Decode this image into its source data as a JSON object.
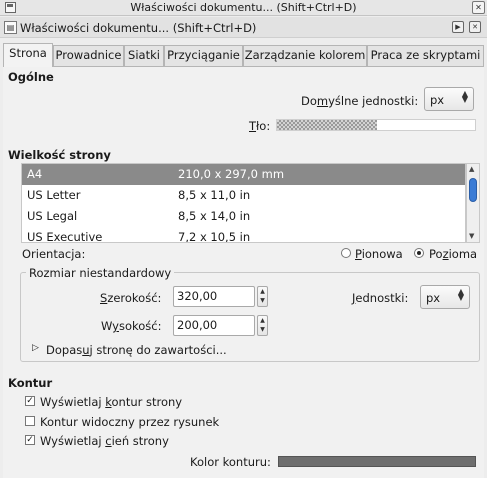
{
  "window": {
    "title": "Właściwości dokumentu... (Shift+Ctrl+D)"
  },
  "dock": {
    "title": "Właściwości dokumentu... (Shift+Ctrl+D)"
  },
  "tabs": [
    {
      "label": "Strona"
    },
    {
      "label": "Prowadnice"
    },
    {
      "label": "Siatki"
    },
    {
      "label": "Przyciąganie"
    },
    {
      "label": "Zarządzanie kolorem"
    },
    {
      "label": "Praca ze skryptami"
    }
  ],
  "general": {
    "heading": "Ogólne",
    "units_label_pre": "Do",
    "units_label_u": "m",
    "units_label_post": "yślne jednostki:",
    "units_value": "px",
    "background_label_u": "T",
    "background_label_post": "ło:"
  },
  "page_size": {
    "heading": "Wielkość strony",
    "rows": [
      {
        "name": "A4",
        "size": "210,0 x 297,0 mm"
      },
      {
        "name": "US Letter",
        "size": "8,5 x 11,0 in"
      },
      {
        "name": "US Legal",
        "size": "8,5 x 14,0 in"
      },
      {
        "name": "US Executive",
        "size": "7,2 x 10,5 in"
      }
    ],
    "selected_index": 0
  },
  "orientation": {
    "label": "Orientacja:",
    "portrait_u": "P",
    "portrait_post": "ionowa",
    "landscape_pre": "Po",
    "landscape_u": "z",
    "landscape_post": "ioma",
    "selected": "landscape"
  },
  "custom_size": {
    "legend": "Rozmiar niestandardowy",
    "width_label_u": "S",
    "width_label_post": "zerokość:",
    "width_value": "320,00",
    "height_label_pre": "W",
    "height_label_u": "y",
    "height_label_post": "sokość:",
    "height_value": "200,00",
    "units_label_u": "J",
    "units_label_post": "ednostki:",
    "units_value": "px",
    "resize_pre": "Dopas",
    "resize_u": "u",
    "resize_post": "j stronę do zawartości..."
  },
  "border": {
    "heading": "Kontur",
    "show_border_pre": "Wyświetlaj ",
    "show_border_u": "k",
    "show_border_post": "ontur strony",
    "show_border_checked": true,
    "on_top_label": "Kontur widoczny przez rysunek",
    "on_top_checked": false,
    "shadow_pre": "Wyświetlaj ",
    "shadow_u": "c",
    "shadow_post": "ień strony",
    "shadow_checked": true,
    "color_label": "Kolor konturu:",
    "color_value": "#6e6e6e"
  }
}
